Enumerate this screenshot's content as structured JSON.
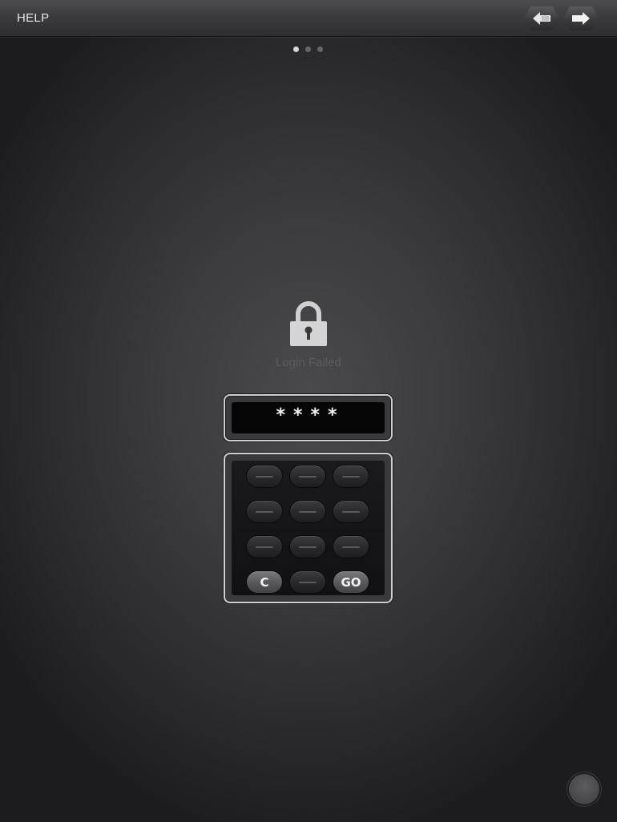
{
  "header": {
    "help_label": "HELP",
    "back_icon": "back-arrow-icon",
    "forward_icon": "forward-arrow-icon"
  },
  "pager": {
    "total": 3,
    "active": 1
  },
  "login": {
    "lock_icon": "padlock-icon",
    "status": "Login Failed",
    "password_mask": "****"
  },
  "keypad": {
    "clear_label": "C",
    "go_label": "GO",
    "rows": 4,
    "columns": 3
  },
  "colors": {
    "background": "#3b3b3d",
    "frame_border": "#cfcfcf",
    "field": "#050505",
    "status_text": "#5c5c5e"
  }
}
